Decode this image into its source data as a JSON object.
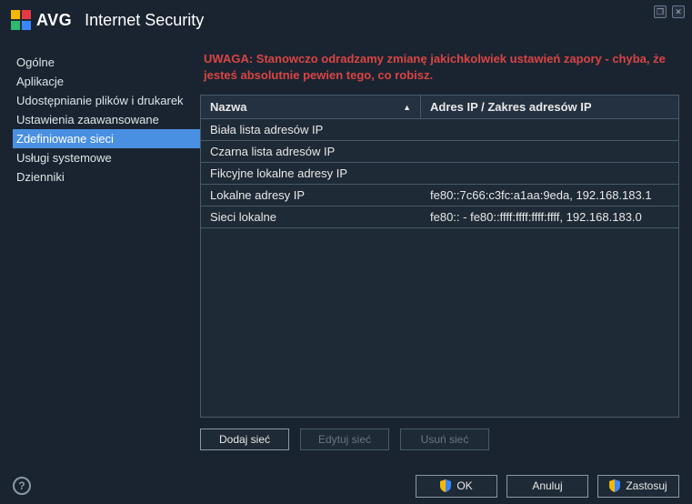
{
  "window": {
    "logo_text": "AVG",
    "title": "Internet Security",
    "restore_icon": "❐",
    "close_icon": "✕"
  },
  "sidebar": {
    "items": [
      {
        "label": "Ogólne"
      },
      {
        "label": "Aplikacje"
      },
      {
        "label": "Udostępnianie plików i drukarek"
      },
      {
        "label": "Ustawienia zaawansowane"
      },
      {
        "label": "Zdefiniowane sieci",
        "active": true
      },
      {
        "label": "Usługi systemowe"
      },
      {
        "label": "Dzienniki"
      }
    ]
  },
  "main": {
    "warning": "UWAGA: Stanowczo odradzamy zmianę jakichkolwiek ustawień zapory - chyba, że jesteś absolutnie pewien tego, co robisz.",
    "table": {
      "header_name": "Nazwa",
      "header_ip": "Adres IP / Zakres adresów IP",
      "sort_indicator": "▲",
      "rows": [
        {
          "name": "Biała lista adresów IP",
          "ip": ""
        },
        {
          "name": "Czarna lista adresów IP",
          "ip": ""
        },
        {
          "name": "Fikcyjne lokalne adresy IP",
          "ip": ""
        },
        {
          "name": "Lokalne adresy IP",
          "ip": "fe80::7c66:c3fc:a1aa:9eda, 192.168.183.1"
        },
        {
          "name": "Sieci lokalne",
          "ip": "fe80:: - fe80::ffff:ffff:ffff:ffff, 192.168.183.0"
        }
      ]
    },
    "actions": {
      "add": "Dodaj sieć",
      "edit": "Edytuj sieć",
      "delete": "Usuń sieć"
    }
  },
  "footer": {
    "help": "?",
    "ok": "OK",
    "cancel": "Anuluj",
    "apply": "Zastosuj"
  }
}
